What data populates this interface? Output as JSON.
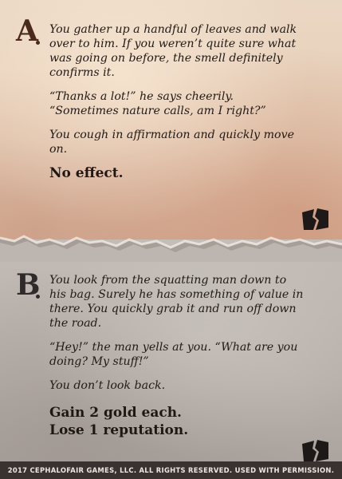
{
  "option_a": {
    "letter": "A",
    "paragraphs": [
      "You gather up a handful of leaves and walk over to him. If you weren’t quite sure what was going on before, the smell definitely confirms it.",
      "“Thanks a lot!” he says cheerily. “Sometimes nature calls, am I right?”",
      "You cough in affirmation and quickly move on."
    ],
    "effects": [
      "No effect."
    ],
    "icon": "broken-card-icon"
  },
  "option_b": {
    "letter": "B",
    "paragraphs": [
      "You look from the squatting man down to his bag. Surely he has something of value in there. You quickly grab it and run off down the road.",
      "“Hey!” the man yells at you. “What are you doing? My stuff!”",
      "You don’t look back."
    ],
    "effects": [
      "Gain 2 gold each.",
      "Lose 1 reputation."
    ],
    "icon": "broken-card-icon"
  },
  "footer": "2017 CEPHALOFAIR GAMES, LLC. ALL RIGHTS RESERVED. USED WITH PERMISSION.",
  "colors": {
    "parchment_top": "#e6cdb7",
    "parchment_bottom": "#a9a19c",
    "ink": "#221a16",
    "letter_a": "#4a2a1c"
  }
}
